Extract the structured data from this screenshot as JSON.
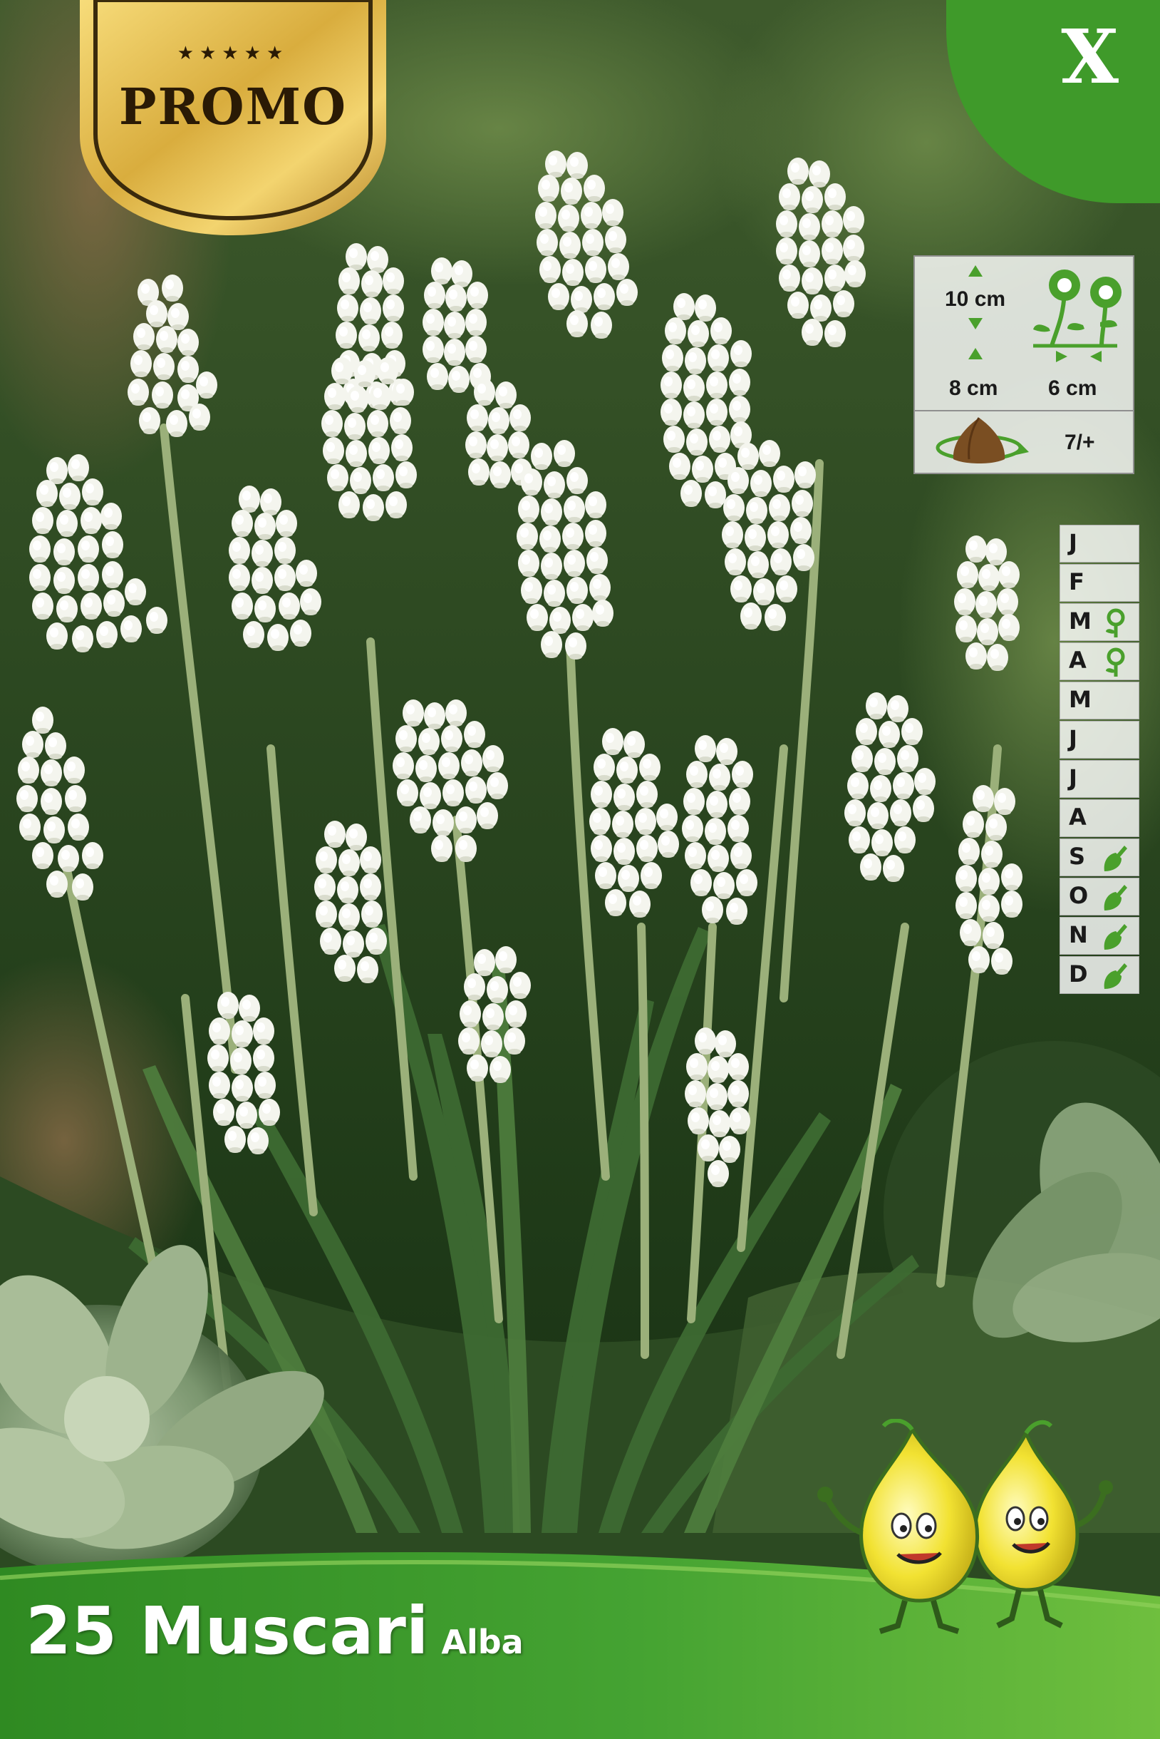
{
  "promo": {
    "stars": "★★★★★",
    "label": "PROMO"
  },
  "bulb_size": "X",
  "planting_info": {
    "height_label": "10 cm",
    "depth_label": "8 cm",
    "spacing_label": "6 cm",
    "bulb_size_range": "7/+"
  },
  "calendar": {
    "months": [
      {
        "letter": "J",
        "icon": ""
      },
      {
        "letter": "F",
        "icon": ""
      },
      {
        "letter": "M",
        "icon": "flower-icon"
      },
      {
        "letter": "A",
        "icon": "flower-icon"
      },
      {
        "letter": "M",
        "icon": ""
      },
      {
        "letter": "J",
        "icon": ""
      },
      {
        "letter": "J",
        "icon": ""
      },
      {
        "letter": "A",
        "icon": ""
      },
      {
        "letter": "S",
        "icon": "trowel-icon"
      },
      {
        "letter": "O",
        "icon": "trowel-icon"
      },
      {
        "letter": "N",
        "icon": "trowel-icon"
      },
      {
        "letter": "D",
        "icon": "trowel-icon"
      }
    ]
  },
  "product": {
    "title": "25 Muscari",
    "variety": "Alba"
  },
  "colors": {
    "brand_green": "#3f9a2a",
    "gold": "#d9ad3e",
    "icon_green": "#4aa02c"
  }
}
